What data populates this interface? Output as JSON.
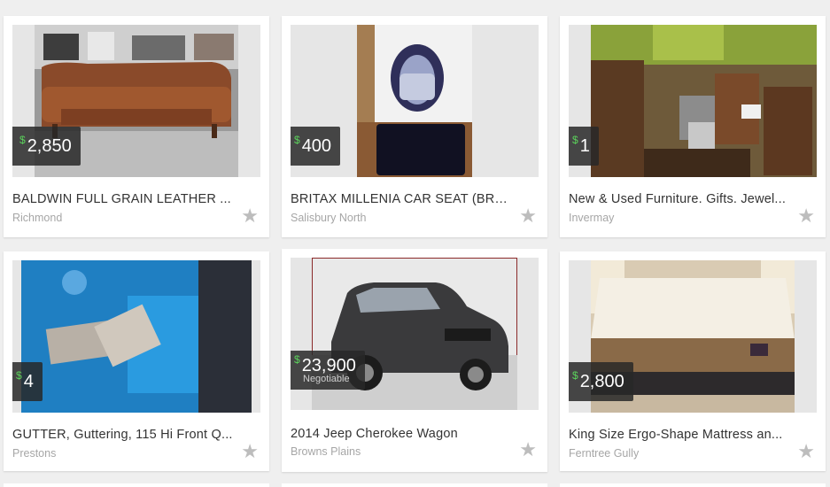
{
  "listings": [
    {
      "title": "BALDWIN FULL GRAIN LEATHER ...",
      "location": "Richmond",
      "currency": "$",
      "price": "2,850",
      "negotiable": ""
    },
    {
      "title": "BRITAX MILLENIA CAR SEAT (BRA...",
      "location": "Salisbury North",
      "currency": "$",
      "price": "400",
      "negotiable": ""
    },
    {
      "title": "New & Used Furniture. Gifts. Jewel...",
      "location": "Invermay",
      "currency": "$",
      "price": "1",
      "negotiable": ""
    },
    {
      "title": "GUTTER, Guttering, 115 Hi Front Q...",
      "location": "Prestons",
      "currency": "$",
      "price": "4",
      "negotiable": ""
    },
    {
      "title": "2014 Jeep Cherokee Wagon",
      "location": "Browns Plains",
      "currency": "$",
      "price": "23,900",
      "negotiable": "Negotiable"
    },
    {
      "title": "King Size Ergo-Shape Mattress an...",
      "location": "Ferntree Gully",
      "currency": "$",
      "price": "2,800",
      "negotiable": ""
    }
  ],
  "icons": {
    "favorite": "star-icon"
  },
  "colors": {
    "currency_symbol": "#5bd25b",
    "price_badge": "#282828",
    "star": "#bdbdbd"
  }
}
